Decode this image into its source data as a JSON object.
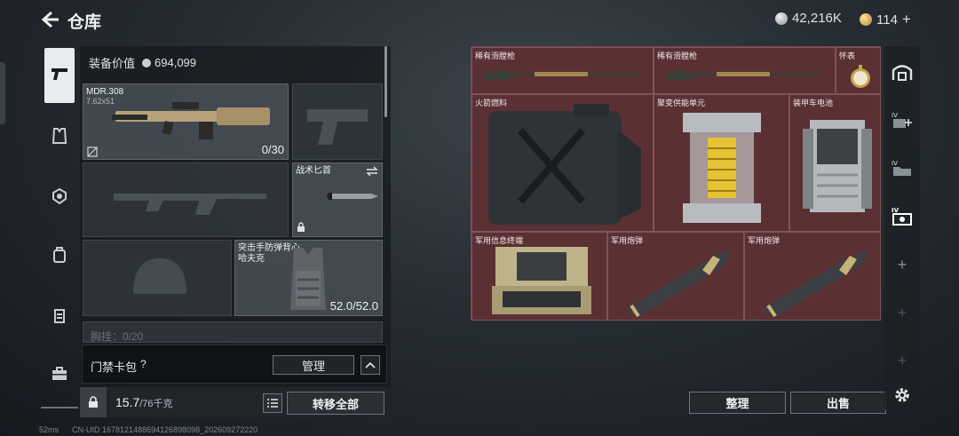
{
  "header": {
    "title": "仓库",
    "currency_primary": "42,216K",
    "currency_secondary": "114",
    "currency_add": "+"
  },
  "equipment": {
    "value_label": "装备价值",
    "value": "694,099",
    "weapon_primary": {
      "name": "MDR.308",
      "caliber": "7.62x51",
      "ammo": "0/30"
    },
    "knife": {
      "name": "战术匕首"
    },
    "armor": {
      "name": "突击手防弹背心",
      "sub": "哈夫克",
      "durability": "52.0/52.0"
    },
    "chest_rig_label": "胸挂：0/20"
  },
  "keycard": {
    "label": "门禁卡包",
    "help": "?",
    "manage": "管理"
  },
  "bottom": {
    "weight": "15.7",
    "weight_max": "/76千克",
    "transfer_all": "转移全部"
  },
  "stash": {
    "items": [
      {
        "name": "稀有滑膛枪"
      },
      {
        "name": "稀有滑膛枪"
      },
      {
        "name": "怀表"
      },
      {
        "name": "火箭燃料"
      },
      {
        "name": "聚变供能单元"
      },
      {
        "name": "装甲车电池"
      },
      {
        "name": "军用信息终端"
      },
      {
        "name": "军用炮弹"
      },
      {
        "name": "军用炮弹"
      }
    ],
    "sort": "整理",
    "sell": "出售"
  },
  "footer": {
    "ping": "52ms",
    "uid": "CN-UID 1678121488694126898098_202609272220"
  },
  "colors": {
    "stash_bg": "#5a2f32",
    "accent_active": "#e9ecee",
    "coin_silver": "#c9cdd1",
    "coin_gold": "#d6a848"
  }
}
